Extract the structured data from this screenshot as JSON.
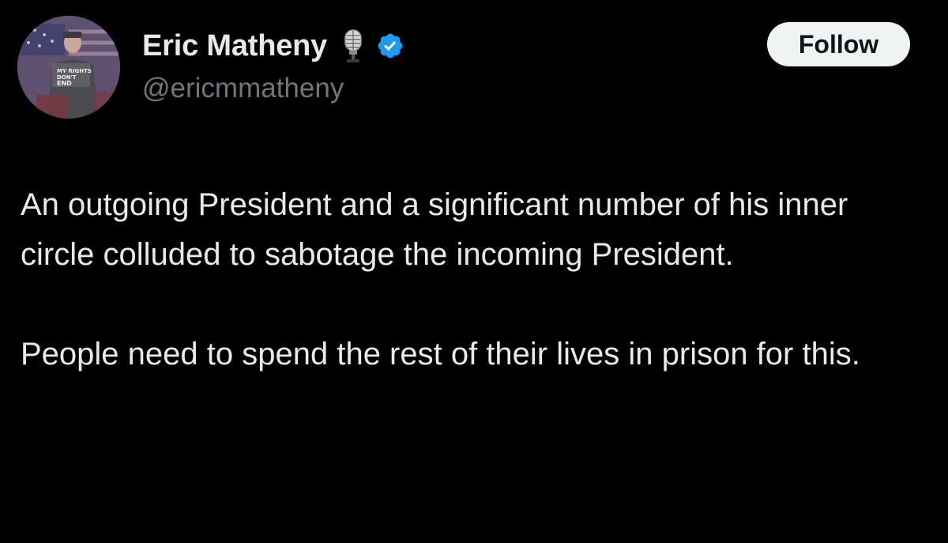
{
  "author": {
    "display_name": "Eric Matheny",
    "handle": "@ericmmatheny",
    "avatar_icon": "profile-photo",
    "avatar_text": "MY RIGHTS DON'T END WHERE YOUR FEELINGS BEGIN",
    "badges": [
      "microphone-icon",
      "verified-badge-icon"
    ],
    "verified_color": "#1d9bf0"
  },
  "actions": {
    "follow_label": "Follow"
  },
  "tweet": {
    "paragraphs": [
      "An outgoing President and a significant number of his inner circle colluded to sabotage the incoming President.",
      "People need to spend the rest of their lives in prison for this."
    ]
  },
  "colors": {
    "background": "#000000",
    "text_primary": "#e7e9ea",
    "text_secondary": "#71767b",
    "button_bg": "#eff3f4",
    "button_text": "#0f1419"
  }
}
